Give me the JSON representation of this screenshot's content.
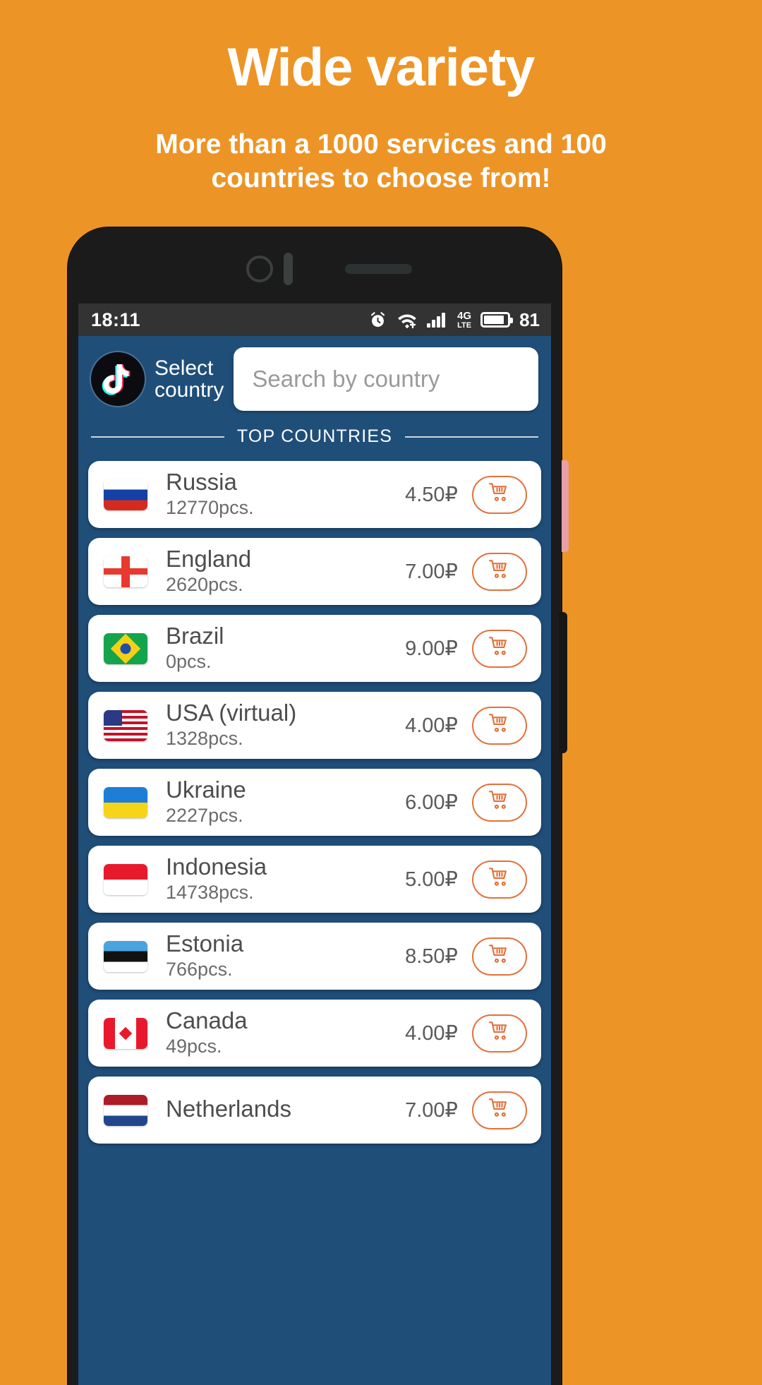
{
  "promo": {
    "title": "Wide variety",
    "subtitle": "More than a 1000 services and 100 countries to choose from!"
  },
  "colors": {
    "background": "#ED9426",
    "app_background": "#1f4e79",
    "accent": "#E2713A",
    "card": "#FFFFFF"
  },
  "status_bar": {
    "time": "18:11",
    "network_type_line1": "4G",
    "network_type_line2": "LTE",
    "battery_percent": "81",
    "icons": [
      "alarm-icon",
      "wifi-icon",
      "signal-icon",
      "lte-badge",
      "battery-icon"
    ]
  },
  "appbar": {
    "app_logo": "tiktok-logo",
    "select_label": "Select\ncountry",
    "search_placeholder": "Search by country",
    "search_value": ""
  },
  "section": {
    "label": "TOP COUNTRIES"
  },
  "countries": [
    {
      "name": "Russia",
      "qty": "12770pcs.",
      "price": "4.50₽",
      "flag": "f-ru",
      "flag_name": "flag-russia"
    },
    {
      "name": "England",
      "qty": "2620pcs.",
      "price": "7.00₽",
      "flag": "f-en",
      "flag_name": "flag-england"
    },
    {
      "name": "Brazil",
      "qty": "0pcs.",
      "price": "9.00₽",
      "flag": "f-br",
      "flag_name": "flag-brazil"
    },
    {
      "name": "USA (virtual)",
      "qty": "1328pcs.",
      "price": "4.00₽",
      "flag": "f-us",
      "flag_name": "flag-usa"
    },
    {
      "name": "Ukraine",
      "qty": "2227pcs.",
      "price": "6.00₽",
      "flag": "f-ua",
      "flag_name": "flag-ukraine"
    },
    {
      "name": "Indonesia",
      "qty": "14738pcs.",
      "price": "5.00₽",
      "flag": "f-id",
      "flag_name": "flag-indonesia"
    },
    {
      "name": "Estonia",
      "qty": "766pcs.",
      "price": "8.50₽",
      "flag": "f-ee",
      "flag_name": "flag-estonia"
    },
    {
      "name": "Canada",
      "qty": "49pcs.",
      "price": "4.00₽",
      "flag": "f-ca",
      "flag_name": "flag-canada"
    },
    {
      "name": "Netherlands",
      "qty": "",
      "price": "7.00₽",
      "flag": "f-nl",
      "flag_name": "flag-netherlands"
    }
  ],
  "cart_button_label": "cart-icon"
}
